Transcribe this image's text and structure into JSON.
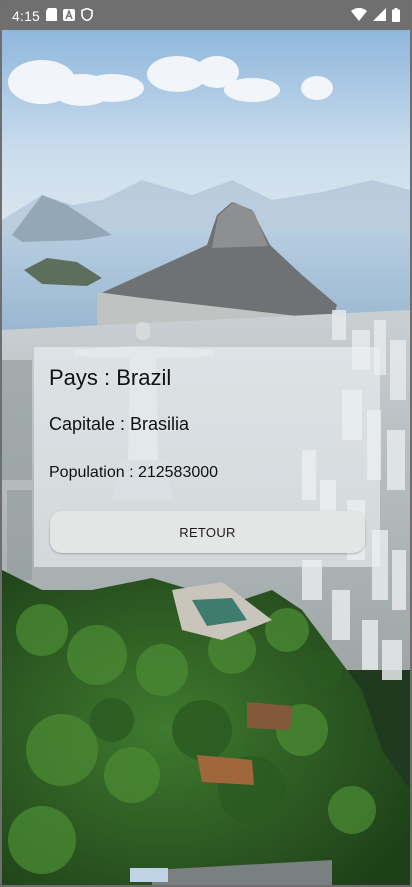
{
  "status_bar": {
    "time": "4:15",
    "left_icons": [
      "sd-card-icon",
      "a-badge-icon",
      "shield-icon"
    ],
    "right_icons": [
      "wifi-icon",
      "signal-icon",
      "battery-icon"
    ]
  },
  "card": {
    "country_label": "Pays : Brazil",
    "capital_label": "Capitale : Brasilia",
    "population_label": "Population : 212583000",
    "back_button_label": "RETOUR"
  },
  "background": {
    "description_icon": "rio-de-janeiro-photo",
    "sky_color": "#cfe0ee",
    "water_color": "#a9c3da",
    "mountain_color": "#6e6f70",
    "forest_color": "#2b5a22"
  }
}
